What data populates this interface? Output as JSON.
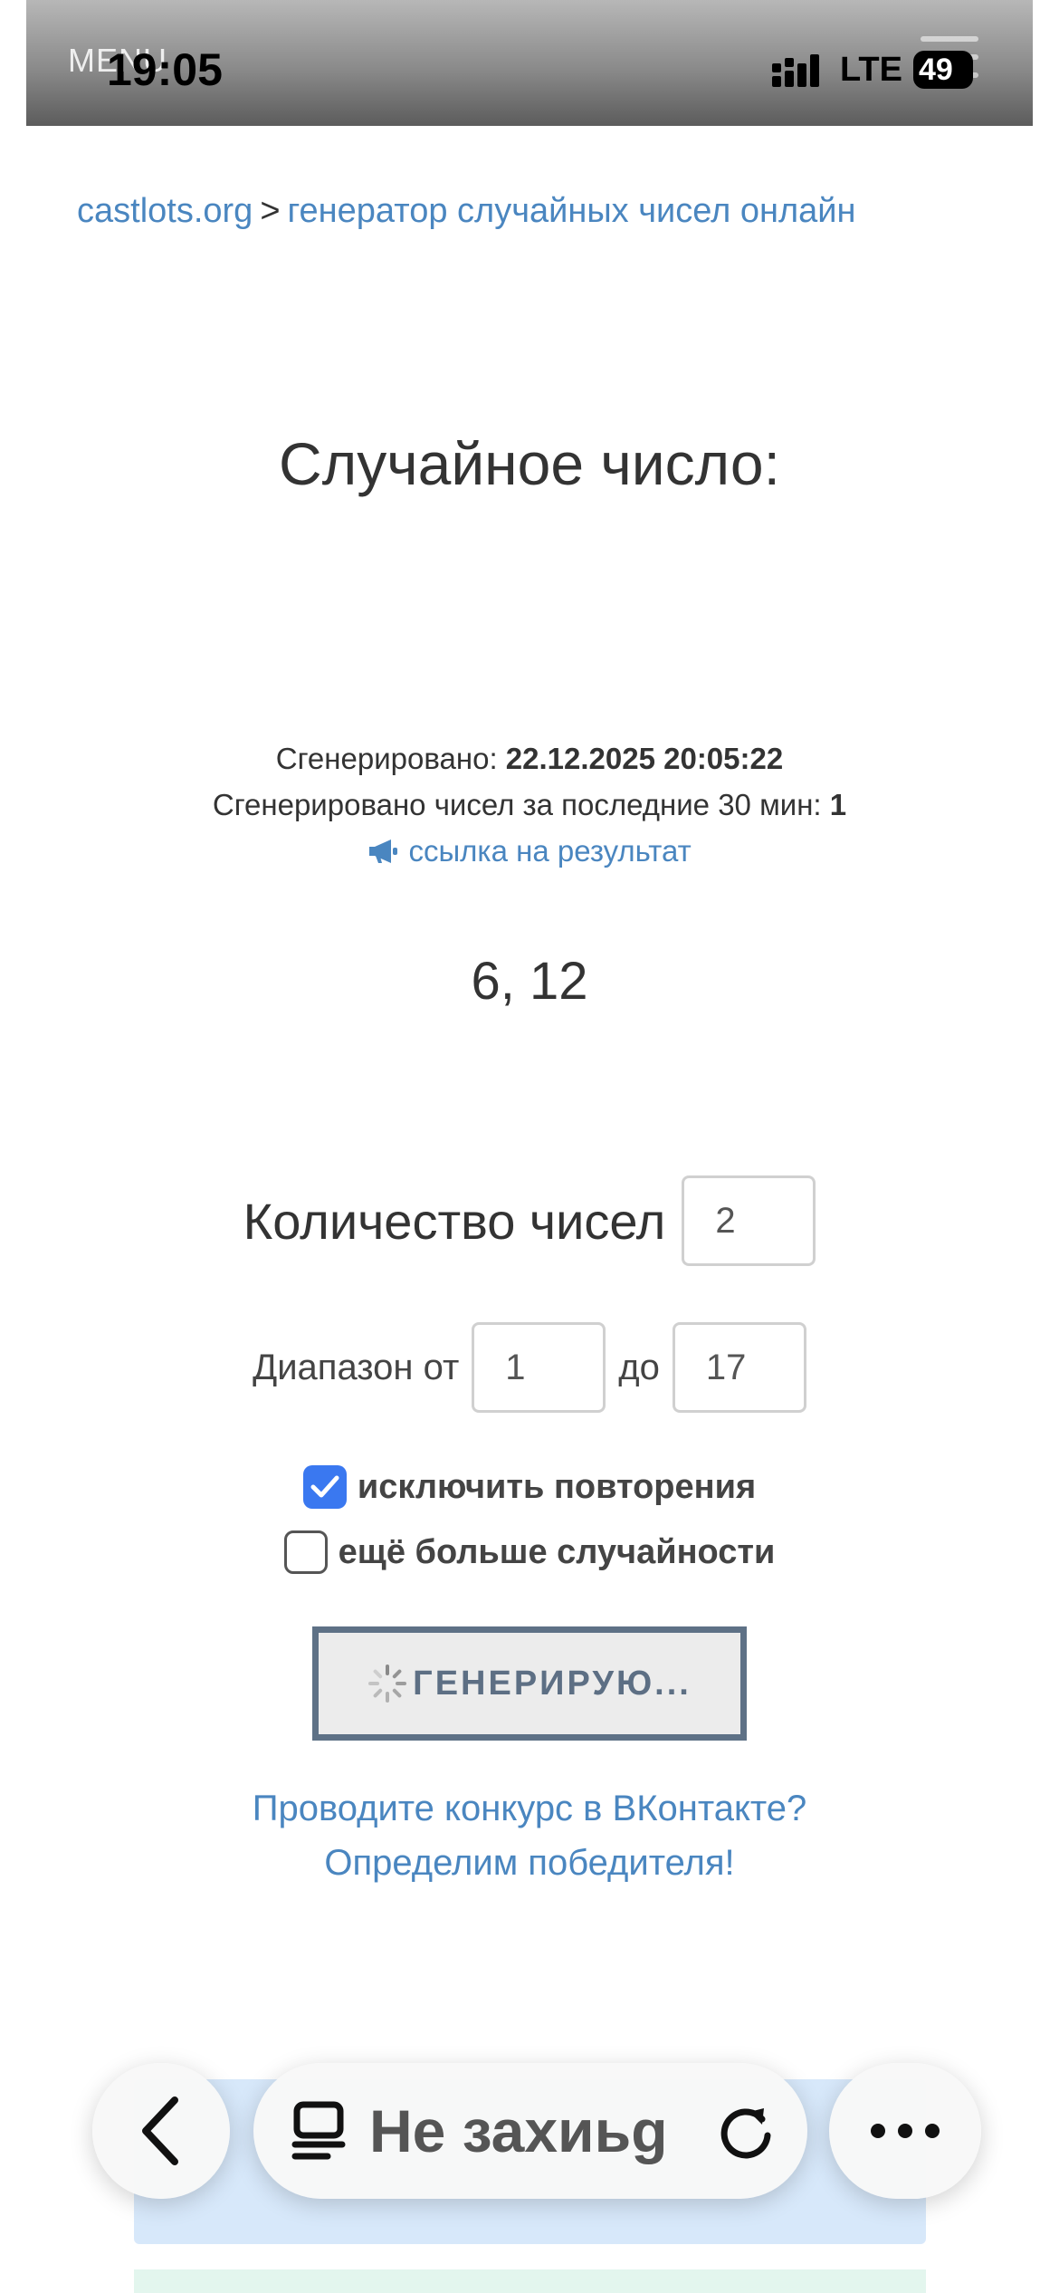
{
  "status_bar": {
    "menu_ghost": "MENU",
    "time": "19:05",
    "network": "LTE",
    "battery": "49"
  },
  "breadcrumb": {
    "home": "castlots.org",
    "separator": ">",
    "current": "генератор случайных чисел онлайн"
  },
  "heading": "Случайное число:",
  "info": {
    "generated_label": "Сгенерировано: ",
    "generated_value": "22.12.2025 20:05:22",
    "count_label": "Сгенерировано чисел за последние 30 мин: ",
    "count_value": "1",
    "result_link": "ссылка на результат"
  },
  "result_numbers": "6, 12",
  "form": {
    "count_label": "Количество чисел",
    "count_value": "2",
    "range_from_label": "Диапазон от",
    "range_from_value": "1",
    "range_to_label": "до",
    "range_to_value": "17",
    "exclude_repeats_label": "исключить повторения",
    "exclude_repeats_checked": true,
    "more_random_label": "ещё больше случайности",
    "more_random_checked": false,
    "generate_button": "ГЕНЕРИРУЮ..."
  },
  "promo": {
    "line1": "Проводите конкурс в ВКонтакте?",
    "line2": "Определим победителя!"
  },
  "browser_bar": {
    "url_text": "Не захиьg"
  },
  "colors": {
    "link": "#4a86c0",
    "checkbox_on": "#3a78f0",
    "button_border": "#5e7186"
  }
}
